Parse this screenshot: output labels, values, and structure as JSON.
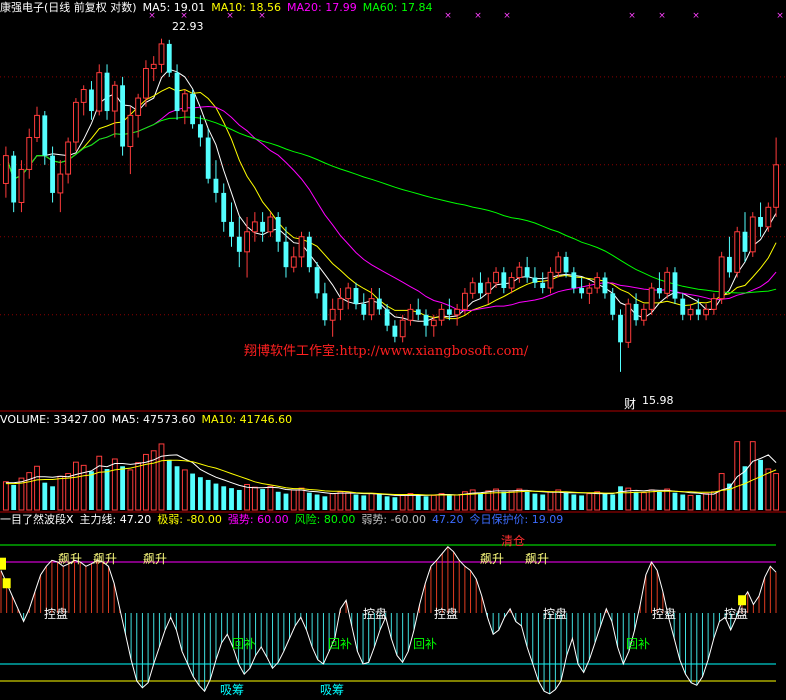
{
  "colors": {
    "background": "#000000",
    "up": "#ff3c3c",
    "down": "#54ffff",
    "ma5": "#ffffff",
    "ma10": "#ffff00",
    "ma20": "#ff00ff",
    "ma60": "#00ff00",
    "divider": "#b00000",
    "watermark": "#ff2020",
    "indicator_value": "#3c6cff"
  },
  "header_price": {
    "title": "康强电子(日线 前复权 对数)",
    "ma5": "MA5: 19.01",
    "ma10": "MA10: 18.56",
    "ma20": "MA20: 17.99",
    "ma60": "MA60: 17.84"
  },
  "header_volume": {
    "volume": "VOLUME: 33427.00",
    "ma5": "MA5: 47573.60",
    "ma10": "MA10: 41746.60"
  },
  "header_indicator": {
    "name": "一目了然波段X",
    "main": "主力线: 47.20",
    "extreme_weak": "极弱: -80.00",
    "strong": "强势: 60.00",
    "risk": "风险: 80.00",
    "weak": "弱势: -60.00",
    "value": "47.20",
    "protect": "今日保护价: 19.09"
  },
  "watermark": "翔博软件工作室:http://www.xiangbosoft.com/",
  "price_labels": {
    "high": "22.93",
    "low": "15.98",
    "low_tag": "财"
  },
  "indicator_labels": {
    "rise": "飙升",
    "sell": "清仓",
    "control": "控盘",
    "rebound": "回补",
    "absorb": "吸筹"
  },
  "chart_data": [
    {
      "type": "candlestick",
      "title": "康强电子(日线 前复权 对数)",
      "ylim": [
        15.5,
        23.5
      ],
      "y_scale": "log",
      "candles": [
        [
          19.6,
          20.4,
          19.3,
          20.2
        ],
        [
          20.2,
          20.3,
          19.0,
          19.2
        ],
        [
          19.2,
          20.1,
          19.0,
          19.9
        ],
        [
          19.9,
          20.8,
          19.7,
          20.6
        ],
        [
          20.6,
          21.3,
          20.5,
          21.1
        ],
        [
          21.1,
          21.2,
          20.0,
          20.2
        ],
        [
          20.2,
          20.4,
          19.2,
          19.4
        ],
        [
          19.4,
          20.1,
          19.0,
          19.8
        ],
        [
          19.8,
          20.6,
          19.6,
          20.5
        ],
        [
          20.5,
          21.5,
          20.3,
          21.4
        ],
        [
          21.4,
          21.8,
          21.1,
          21.7
        ],
        [
          21.7,
          21.9,
          21.0,
          21.2
        ],
        [
          21.2,
          22.3,
          21.1,
          22.1
        ],
        [
          22.1,
          22.3,
          21.0,
          21.2
        ],
        [
          21.2,
          21.9,
          20.6,
          21.8
        ],
        [
          21.8,
          22.0,
          20.2,
          20.4
        ],
        [
          20.4,
          21.3,
          19.8,
          21.1
        ],
        [
          21.1,
          21.6,
          20.6,
          21.5
        ],
        [
          21.5,
          22.4,
          21.3,
          22.2
        ],
        [
          22.2,
          22.5,
          21.9,
          22.3
        ],
        [
          22.3,
          22.93,
          22.1,
          22.8
        ],
        [
          22.8,
          22.9,
          22.0,
          22.1
        ],
        [
          22.1,
          22.3,
          21.0,
          21.2
        ],
        [
          21.2,
          21.7,
          20.9,
          21.6
        ],
        [
          21.6,
          21.7,
          20.8,
          20.9
        ],
        [
          20.9,
          21.1,
          20.4,
          20.6
        ],
        [
          20.6,
          20.8,
          19.6,
          19.7
        ],
        [
          19.7,
          20.1,
          19.2,
          19.4
        ],
        [
          19.4,
          19.6,
          18.6,
          18.8
        ],
        [
          18.8,
          19.2,
          18.3,
          18.5
        ],
        [
          18.5,
          18.9,
          17.9,
          18.2
        ],
        [
          18.2,
          18.9,
          17.7,
          18.6
        ],
        [
          18.6,
          19.0,
          18.4,
          18.8
        ],
        [
          18.8,
          19.0,
          18.4,
          18.6
        ],
        [
          18.6,
          19.0,
          18.5,
          18.9
        ],
        [
          18.9,
          19.0,
          18.2,
          18.4
        ],
        [
          18.4,
          18.7,
          17.7,
          17.9
        ],
        [
          17.9,
          18.3,
          17.8,
          18.1
        ],
        [
          18.1,
          18.6,
          17.9,
          18.5
        ],
        [
          18.5,
          18.6,
          17.8,
          17.9
        ],
        [
          17.9,
          18.0,
          17.3,
          17.4
        ],
        [
          17.4,
          17.6,
          16.8,
          16.9
        ],
        [
          16.9,
          17.3,
          16.6,
          17.1
        ],
        [
          17.1,
          17.5,
          16.9,
          17.3
        ],
        [
          17.3,
          17.6,
          17.1,
          17.5
        ],
        [
          17.5,
          17.6,
          17.1,
          17.2
        ],
        [
          17.2,
          17.4,
          16.9,
          17.0
        ],
        [
          17.0,
          17.5,
          16.9,
          17.3
        ],
        [
          17.3,
          17.5,
          17.0,
          17.1
        ],
        [
          17.1,
          17.2,
          16.7,
          16.8
        ],
        [
          16.8,
          16.9,
          16.5,
          16.6
        ],
        [
          16.6,
          17.0,
          16.5,
          16.9
        ],
        [
          16.9,
          17.2,
          16.8,
          17.1
        ],
        [
          17.1,
          17.3,
          16.9,
          17.0
        ],
        [
          17.0,
          17.1,
          16.6,
          16.8
        ],
        [
          16.8,
          17.0,
          16.6,
          16.9
        ],
        [
          16.9,
          17.2,
          16.8,
          17.1
        ],
        [
          17.1,
          17.3,
          16.9,
          17.0
        ],
        [
          17.0,
          17.2,
          16.8,
          17.1
        ],
        [
          17.1,
          17.5,
          17.0,
          17.4
        ],
        [
          17.4,
          17.7,
          17.3,
          17.6
        ],
        [
          17.6,
          17.8,
          17.3,
          17.4
        ],
        [
          17.4,
          17.7,
          17.2,
          17.6
        ],
        [
          17.6,
          17.9,
          17.5,
          17.8
        ],
        [
          17.8,
          17.9,
          17.4,
          17.5
        ],
        [
          17.5,
          17.8,
          17.4,
          17.7
        ],
        [
          17.7,
          18.0,
          17.6,
          17.9
        ],
        [
          17.9,
          18.1,
          17.6,
          17.7
        ],
        [
          17.7,
          17.9,
          17.5,
          17.6
        ],
        [
          17.6,
          17.8,
          17.4,
          17.5
        ],
        [
          17.5,
          17.9,
          17.4,
          17.8
        ],
        [
          17.8,
          18.2,
          17.7,
          18.1
        ],
        [
          18.1,
          18.2,
          17.7,
          17.8
        ],
        [
          17.8,
          17.9,
          17.4,
          17.5
        ],
        [
          17.5,
          17.7,
          17.3,
          17.4
        ],
        [
          17.4,
          17.6,
          17.2,
          17.5
        ],
        [
          17.5,
          17.8,
          17.4,
          17.7
        ],
        [
          17.7,
          17.8,
          17.3,
          17.4
        ],
        [
          17.4,
          17.5,
          16.9,
          17.0
        ],
        [
          17.0,
          17.1,
          15.98,
          16.5
        ],
        [
          16.5,
          17.3,
          16.4,
          17.2
        ],
        [
          17.2,
          17.4,
          16.8,
          16.9
        ],
        [
          16.9,
          17.2,
          16.8,
          17.1
        ],
        [
          17.1,
          17.6,
          17.0,
          17.5
        ],
        [
          17.5,
          17.8,
          17.3,
          17.4
        ],
        [
          17.4,
          17.9,
          17.3,
          17.8
        ],
        [
          17.8,
          17.9,
          17.2,
          17.3
        ],
        [
          17.3,
          17.4,
          16.9,
          17.0
        ],
        [
          17.0,
          17.2,
          16.9,
          17.1
        ],
        [
          17.1,
          17.3,
          16.9,
          17.0
        ],
        [
          17.0,
          17.2,
          16.9,
          17.1
        ],
        [
          17.1,
          17.4,
          17.0,
          17.3
        ],
        [
          17.3,
          18.2,
          17.2,
          18.1
        ],
        [
          18.1,
          18.5,
          17.7,
          17.8
        ],
        [
          17.8,
          18.7,
          17.7,
          18.6
        ],
        [
          18.6,
          19.0,
          18.0,
          18.2
        ],
        [
          18.2,
          19.0,
          18.1,
          18.9
        ],
        [
          18.9,
          19.2,
          18.5,
          18.7
        ],
        [
          18.7,
          19.2,
          18.6,
          19.1
        ],
        [
          19.1,
          20.6,
          18.9,
          20.0
        ]
      ]
    },
    {
      "type": "bar",
      "title": "VOLUME",
      "ylim": [
        0,
        180000
      ],
      "values": [
        62000,
        55000,
        70000,
        82000,
        96000,
        60000,
        52000,
        74000,
        80000,
        105000,
        98000,
        85000,
        118000,
        90000,
        112000,
        96000,
        88000,
        104000,
        122000,
        130000,
        145000,
        110000,
        96000,
        88000,
        80000,
        72000,
        66000,
        58000,
        52000,
        48000,
        44000,
        56000,
        50000,
        46000,
        52000,
        40000,
        36000,
        44000,
        48000,
        38000,
        34000,
        30000,
        36000,
        40000,
        38000,
        34000,
        32000,
        36000,
        34000,
        30000,
        28000,
        32000,
        36000,
        34000,
        30000,
        32000,
        36000,
        34000,
        33000,
        40000,
        44000,
        38000,
        42000,
        46000,
        40000,
        42000,
        46000,
        40000,
        36000,
        34000,
        40000,
        44000,
        38000,
        34000,
        32000,
        36000,
        40000,
        36000,
        34000,
        52000,
        48000,
        40000,
        38000,
        44000,
        40000,
        46000,
        38000,
        34000,
        32000,
        33000,
        36000,
        40000,
        80000,
        58000,
        150000,
        96000,
        150000,
        110000,
        90000,
        80000
      ],
      "ma5": [
        60000,
        60000,
        62000,
        67000,
        73000,
        73000,
        72000,
        74000,
        73000,
        78000,
        82000,
        86000,
        97000,
        95000,
        102000,
        102000,
        100000,
        102000,
        105000,
        110000,
        118000,
        120000,
        121000,
        112000,
        104000,
        89000,
        80000,
        72000,
        66000,
        60000,
        54000,
        50000,
        49000,
        49000,
        50000,
        49000,
        45000,
        44000,
        44000,
        41000,
        40000,
        38000,
        36000,
        37000,
        37000,
        37000,
        36000,
        36000,
        35000,
        34000,
        32000,
        32000,
        32000,
        32000,
        32000,
        33000,
        34000,
        34000,
        33000,
        35000,
        37000,
        38000,
        40000,
        42000,
        42000,
        42000,
        43000,
        43000,
        41000,
        40000,
        39000,
        39000,
        38000,
        38000,
        38000,
        37000,
        36000,
        36000,
        36000,
        40000,
        42000,
        43000,
        42000,
        44000,
        43000,
        43000,
        41000,
        40000,
        38000,
        37000,
        35000,
        35000,
        44000,
        49000,
        73000,
        85000,
        107000,
        113000,
        121000,
        104000
      ],
      "ma10": [
        58000,
        58000,
        59000,
        62000,
        66000,
        67000,
        67000,
        69000,
        70000,
        72000,
        75000,
        77000,
        83000,
        84000,
        88000,
        90000,
        92000,
        96000,
        100000,
        103000,
        108000,
        109000,
        109000,
        108000,
        106000,
        101000,
        96000,
        92000,
        86000,
        80000,
        74000,
        68000,
        62000,
        58000,
        55000,
        52000,
        49000,
        47000,
        47000,
        45000,
        44000,
        42000,
        41000,
        41000,
        40000,
        38000,
        37000,
        37000,
        36000,
        35000,
        34000,
        34000,
        34000,
        34000,
        33000,
        33000,
        33000,
        33000,
        33000,
        34000,
        35000,
        36000,
        37000,
        38000,
        38000,
        39000,
        40000,
        41000,
        41000,
        41000,
        40000,
        40000,
        40000,
        39000,
        38000,
        38000,
        38000,
        37000,
        37000,
        38000,
        38000,
        39000,
        39000,
        40000,
        41000,
        41000,
        41000,
        40000,
        40000,
        39000,
        39000,
        39000,
        43000,
        45000,
        52000,
        58000,
        66000,
        73000,
        81000,
        88000
      ]
    },
    {
      "type": "histogram-line",
      "title": "一目了然波段X",
      "ylim": [
        -100,
        100
      ],
      "levels": {
        "strong": 60,
        "risk": 80,
        "weak": -60,
        "extreme_weak": -80
      },
      "values": [
        50,
        35,
        20,
        5,
        -10,
        5,
        25,
        45,
        55,
        62,
        60,
        55,
        58,
        62,
        60,
        55,
        58,
        62,
        60,
        55,
        35,
        5,
        -25,
        -55,
        -80,
        -88,
        -82,
        -60,
        -40,
        -20,
        -5,
        -20,
        -45,
        -60,
        -75,
        -85,
        -92,
        -78,
        -55,
        -35,
        -25,
        -40,
        -60,
        -72,
        -65,
        -50,
        -40,
        -52,
        -65,
        -58,
        -45,
        -30,
        -15,
        -5,
        -20,
        -40,
        -55,
        -60,
        -45,
        -30,
        5,
        15,
        -15,
        -45,
        -60,
        -58,
        -40,
        -20,
        -5,
        -30,
        -50,
        -58,
        -45,
        -20,
        10,
        35,
        55,
        62,
        70,
        78,
        72,
        62,
        55,
        50,
        40,
        20,
        -5,
        -25,
        -20,
        -5,
        5,
        -10,
        -15,
        -40,
        -60,
        -80,
        -92,
        -95,
        -90,
        -80,
        -50,
        -30,
        -60,
        -70,
        -55,
        -35,
        -15,
        5,
        -10,
        -40,
        -60,
        -45,
        -20,
        10,
        45,
        60,
        50,
        25,
        -5,
        -30,
        -55,
        -72,
        -82,
        -85,
        -75,
        -55,
        -30,
        -10,
        -5,
        -20,
        -5,
        15,
        25,
        10,
        20,
        42,
        55,
        48
      ],
      "markers": {
        "yellow_squares": [
          1,
          131
        ]
      }
    }
  ]
}
